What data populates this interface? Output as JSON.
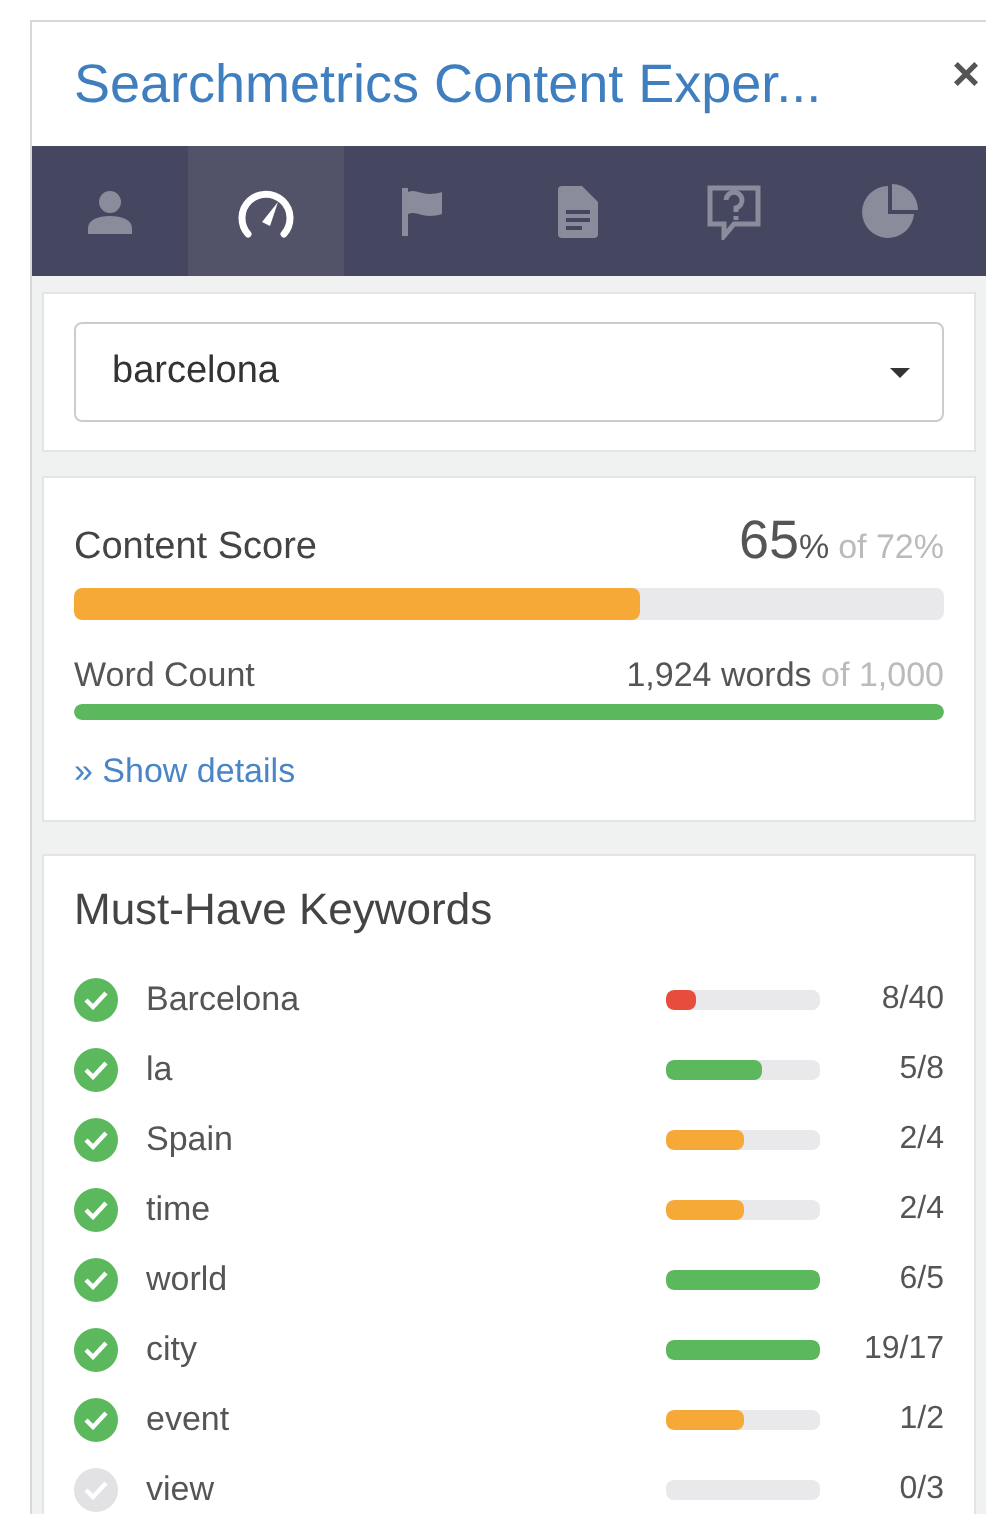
{
  "window": {
    "title": "Searchmetrics Content Exper...",
    "close": "×"
  },
  "tabs": [
    {
      "selected": false
    },
    {
      "selected": true
    },
    {
      "selected": false
    },
    {
      "selected": false
    },
    {
      "selected": false
    },
    {
      "selected": false
    }
  ],
  "topic_select": {
    "value": "barcelona"
  },
  "content_score": {
    "label": "Content Score",
    "value": "65",
    "unit": "%",
    "target": "of 72%",
    "level": 0.65,
    "word_count": {
      "label": "Word Count",
      "value": "1,924 words",
      "target": "of 1,000",
      "level": 1
    },
    "details_link": "» Show details"
  },
  "keywords": {
    "title": "Must-Have Keywords",
    "items": [
      {
        "name": "Barcelona",
        "checked": true,
        "level": 0.2,
        "color": "#e84c3d",
        "count": "8/40"
      },
      {
        "name": "la",
        "checked": true,
        "level": 0.625,
        "color": "#5cb85c",
        "count": "5/8"
      },
      {
        "name": "Spain",
        "checked": true,
        "level": 0.5,
        "color": "#f6a937",
        "count": "2/4"
      },
      {
        "name": "time",
        "checked": true,
        "level": 0.5,
        "color": "#f6a937",
        "count": "2/4"
      },
      {
        "name": "world",
        "checked": true,
        "level": 1,
        "color": "#5cb85c",
        "count": "6/5"
      },
      {
        "name": "city",
        "checked": true,
        "level": 1,
        "color": "#5cb85c",
        "count": "19/17"
      },
      {
        "name": "event",
        "checked": true,
        "level": 0.5,
        "color": "#f6a937",
        "count": "1/2"
      },
      {
        "name": "view",
        "checked": false,
        "level": 0,
        "count": "0/3"
      }
    ]
  }
}
